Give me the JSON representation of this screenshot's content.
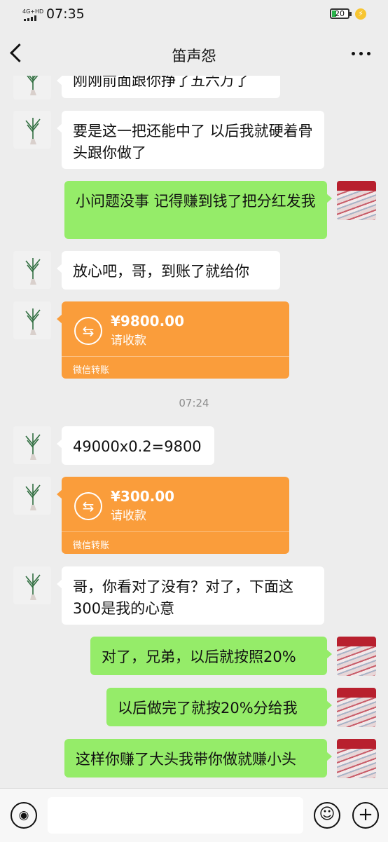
{
  "status_bar": {
    "network": "4G+HD",
    "time": "07:35",
    "battery": "20"
  },
  "header": {
    "title": "笛声怨"
  },
  "messages": [
    {
      "text": "刚刚前面跟你挣了五六万了"
    },
    {
      "text": "要是这一把还能中了 以后我就硬着骨头跟你做了"
    },
    {
      "text": "小问题没事 记得赚到钱了把分红发我"
    },
    {
      "text": "放心吧，哥，到账了就给你"
    },
    {
      "amount": "¥9800.00",
      "status": "请收款",
      "footer": "微信转账"
    },
    {
      "text": "07:24"
    },
    {
      "text": "49000x0.2=9800"
    },
    {
      "amount": "¥300.00",
      "status": "请收款",
      "footer": "微信转账"
    },
    {
      "text": "哥，你看对了没有？对了，下面这300是我的心意"
    },
    {
      "text": "对了，兄弟，以后就按照20%"
    },
    {
      "text": "以后做完了就按20%分给我"
    },
    {
      "text": "这样你赚了大头我带你做就赚小头"
    }
  ],
  "colors": {
    "in_bubble": "#ffffff",
    "out_bubble": "#95ec69",
    "transfer": "#fa9d3b",
    "background": "#ededed"
  },
  "icons": [
    "back-icon",
    "more-icon",
    "voice-icon",
    "emoji-icon",
    "plus-icon",
    "transfer-icon"
  ],
  "input": {
    "placeholder": ""
  }
}
